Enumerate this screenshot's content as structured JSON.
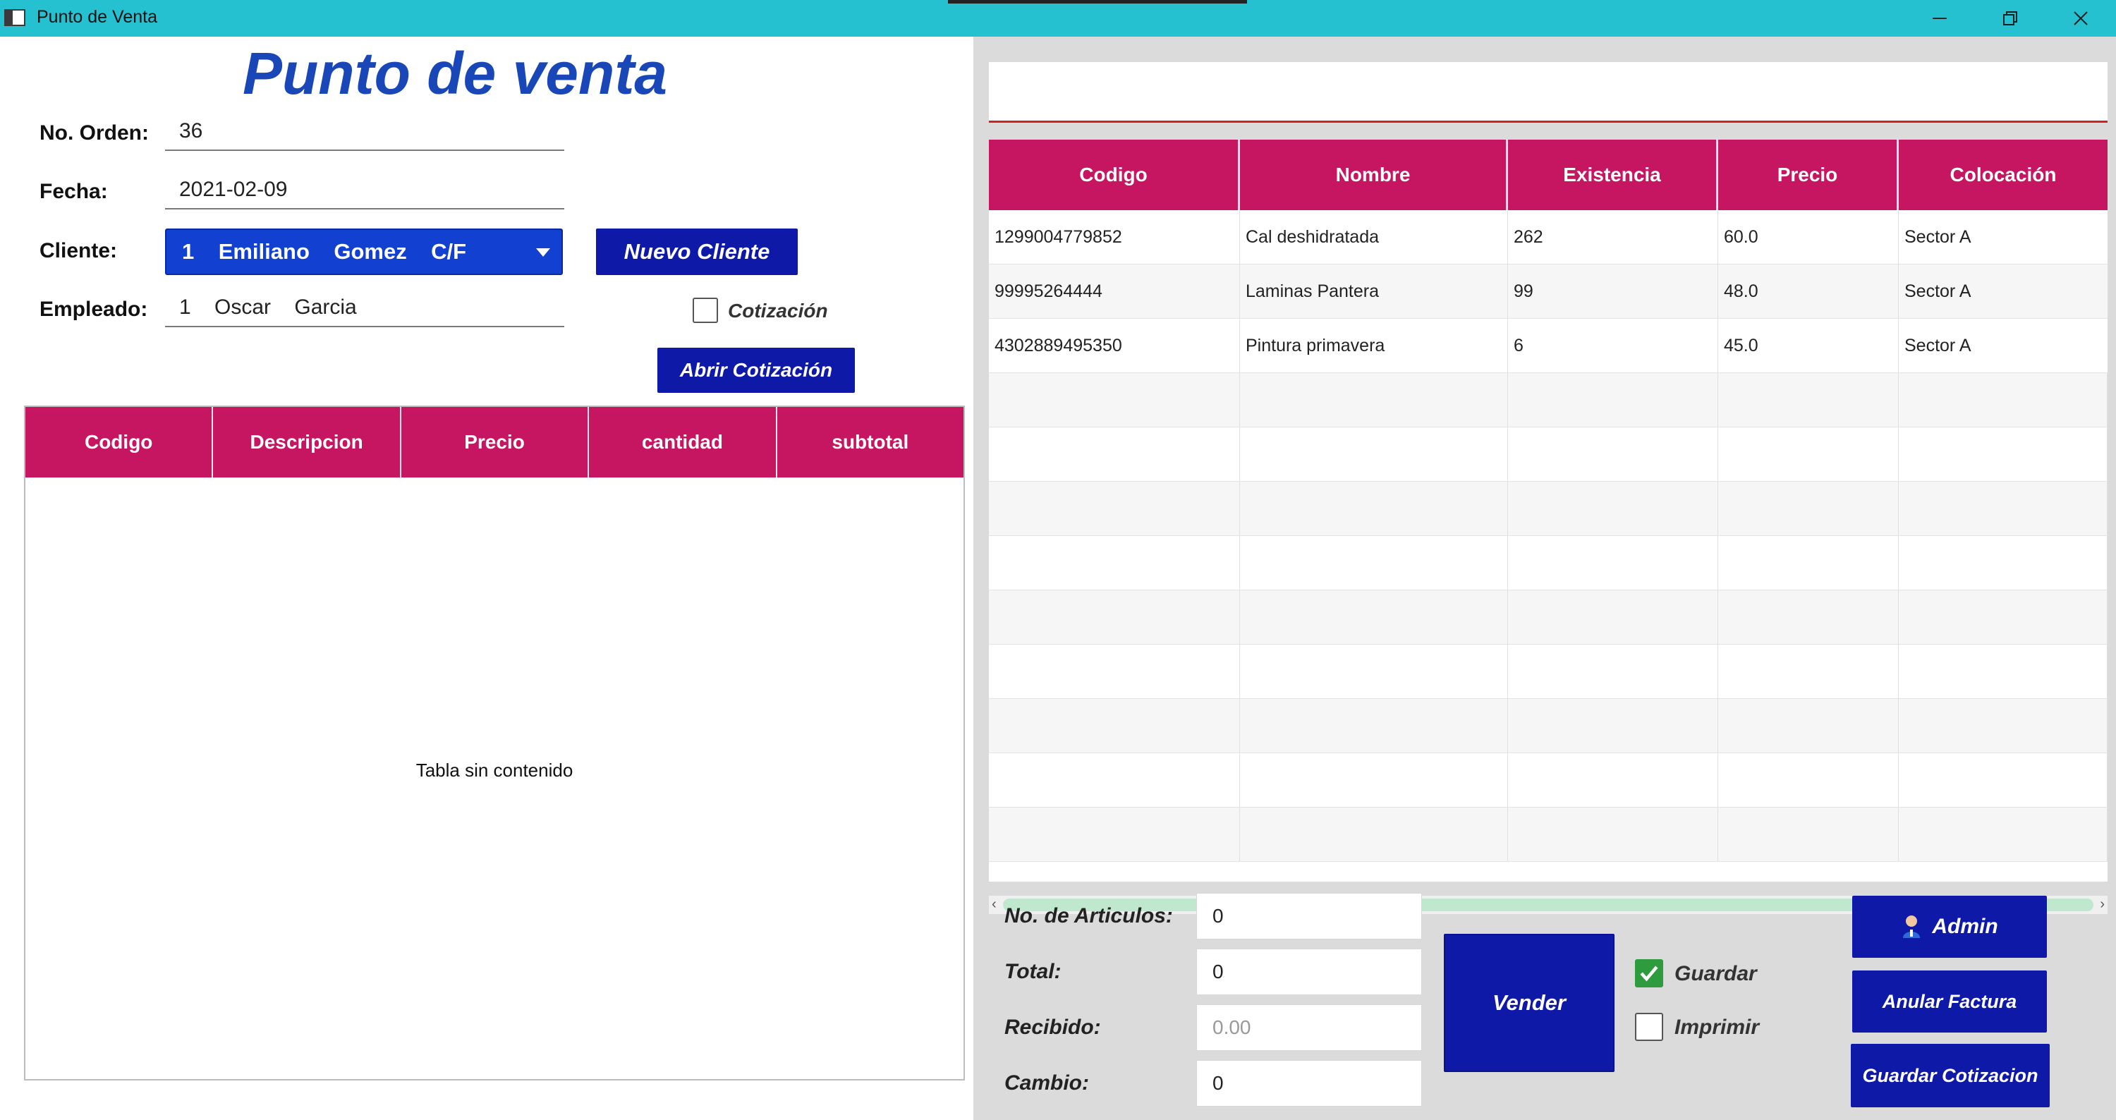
{
  "window": {
    "title": "Punto de Venta"
  },
  "left": {
    "title": "Punto de venta",
    "orden": {
      "label": "No. Orden:",
      "value": "36"
    },
    "fecha": {
      "label": "Fecha:",
      "value": "2021-02-09"
    },
    "cliente": {
      "label": "Cliente:",
      "value": "1    Emiliano    Gomez    C/F"
    },
    "empleado": {
      "label": "Empleado:",
      "value": "1    Oscar    Garcia"
    },
    "nuevo_cliente": "Nuevo Cliente",
    "cotizacion_check": {
      "label": "Cotización",
      "checked": false
    },
    "abrir_cotizacion": "Abrir Cotización",
    "table": {
      "headers": [
        "Codigo",
        "Descripcion",
        "Precio",
        "cantidad",
        "subtotal"
      ],
      "empty_text": "Tabla sin contenido"
    }
  },
  "right": {
    "search_value": "",
    "table": {
      "headers": [
        "Codigo",
        "Nombre",
        "Existencia",
        "Precio",
        "Colocación"
      ],
      "rows": [
        [
          "1299004779852",
          "Cal deshidratada",
          "262",
          "60.0",
          "Sector A"
        ],
        [
          "99995264444",
          "Laminas Pantera",
          "99",
          "48.0",
          "Sector A"
        ],
        [
          "4302889495350",
          "Pintura primavera",
          "6",
          "45.0",
          "Sector A"
        ]
      ]
    },
    "summary": {
      "articulos": {
        "label": "No. de Articulos:",
        "value": "0"
      },
      "total": {
        "label": "Total:",
        "value": "0"
      },
      "recibido": {
        "label": "Recibido:",
        "placeholder": "0.00"
      },
      "cambio": {
        "label": "Cambio:",
        "value": "0"
      }
    },
    "vender": "Vender",
    "guardar": {
      "label": "Guardar",
      "checked": true
    },
    "imprimir": {
      "label": "Imprimir",
      "checked": false
    },
    "admin": "Admin",
    "anular_factura": "Anular Factura",
    "guardar_cotizacion": "Guardar Cotizacion"
  },
  "colors": {
    "titlebar": "#26c1d1",
    "header": "#c61561",
    "navy": "#0f19a8",
    "title": "#1a47b8"
  }
}
